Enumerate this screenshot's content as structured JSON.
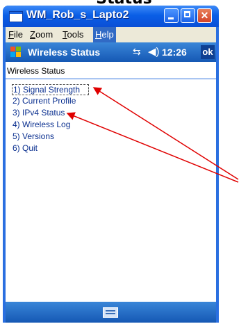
{
  "window": {
    "title": "WM_Rob_s_Lapto2"
  },
  "cut_heading": "Status",
  "menubar": {
    "file": {
      "accel": "F",
      "rest": "ile"
    },
    "zoom": {
      "accel": "Z",
      "rest": "oom"
    },
    "tools": {
      "accel": "T",
      "rest": "ools"
    },
    "help": {
      "accel": "H",
      "rest": "elp"
    }
  },
  "device": {
    "title": "Wireless Status",
    "clock": "12:26",
    "ok_label": "ok",
    "icons": [
      "windows-start-icon",
      "connectivity-icon",
      "speaker-icon",
      "keyboard-icon"
    ]
  },
  "content": {
    "heading": "Wireless Status",
    "options": [
      "1) Signal Strength",
      "2) Current Profile",
      "3) IPv4 Status",
      "4) Wireless Log",
      "5) Versions",
      "6) Quit"
    ]
  },
  "colors": {
    "titlebar": "#0a5ee6",
    "device_bar": "#1558b4",
    "arrow": "#e00000",
    "link_text": "#0a2f8f"
  }
}
